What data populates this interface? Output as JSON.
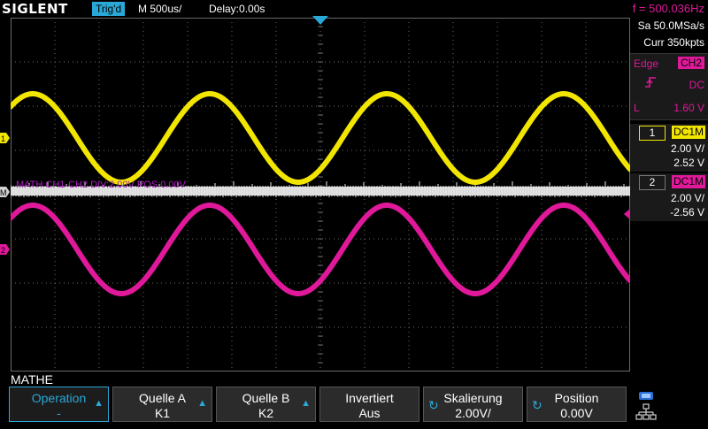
{
  "header": {
    "brand": "SIGLENT",
    "trigger_status": "Trig'd",
    "timebase": "M 500us/",
    "delay": "Delay:0.00s",
    "frequency": "f = 500.036Hz"
  },
  "acquisition": {
    "sample_rate": "Sa 50.0MSa/s",
    "memory": "Curr 350kpts"
  },
  "trigger": {
    "mode": "Edge",
    "source": "CH2",
    "slope_icon": "rising-edge-icon",
    "coupling": "DC",
    "level_label": "L",
    "level": "1.60 V"
  },
  "channels": [
    {
      "number": "1",
      "coupling": "DC1M",
      "vdiv": "2.00 V/",
      "offset": "2.52 V",
      "color": "#f2e600",
      "marker": "1"
    },
    {
      "number": "2",
      "coupling": "DC1M",
      "vdiv": "2.00 V/",
      "offset": "-2.56 V",
      "color": "#e0189a",
      "marker": "2"
    }
  ],
  "math": {
    "marker": "M",
    "label": "MATH  CH1-CH2  DIV:2.00V  POS:0.00V",
    "color": "#ab1fc0"
  },
  "menu": {
    "title": "MATHE",
    "softkeys": [
      {
        "line1": "Operation",
        "line2": "-",
        "indicator": "up-arrow",
        "active": true
      },
      {
        "line1": "Quelle A",
        "line2": "K1",
        "indicator": "up-arrow"
      },
      {
        "line1": "Quelle B",
        "line2": "K2",
        "indicator": "up-arrow"
      },
      {
        "line1": "Invertiert",
        "line2": "Aus",
        "indicator": "none"
      },
      {
        "line1": "Skalierung",
        "line2": "2.00V/",
        "indicator": "knob"
      },
      {
        "line1": "Position",
        "line2": "0.00V",
        "indicator": "knob"
      }
    ]
  },
  "status_icons": [
    "usb-icon",
    "network-icon"
  ],
  "colors": {
    "ch1": "#f2e600",
    "ch2": "#e0189a",
    "math": "#ab1fc0",
    "accent": "#2aa9d9",
    "grid": "#6a6a6a"
  }
}
